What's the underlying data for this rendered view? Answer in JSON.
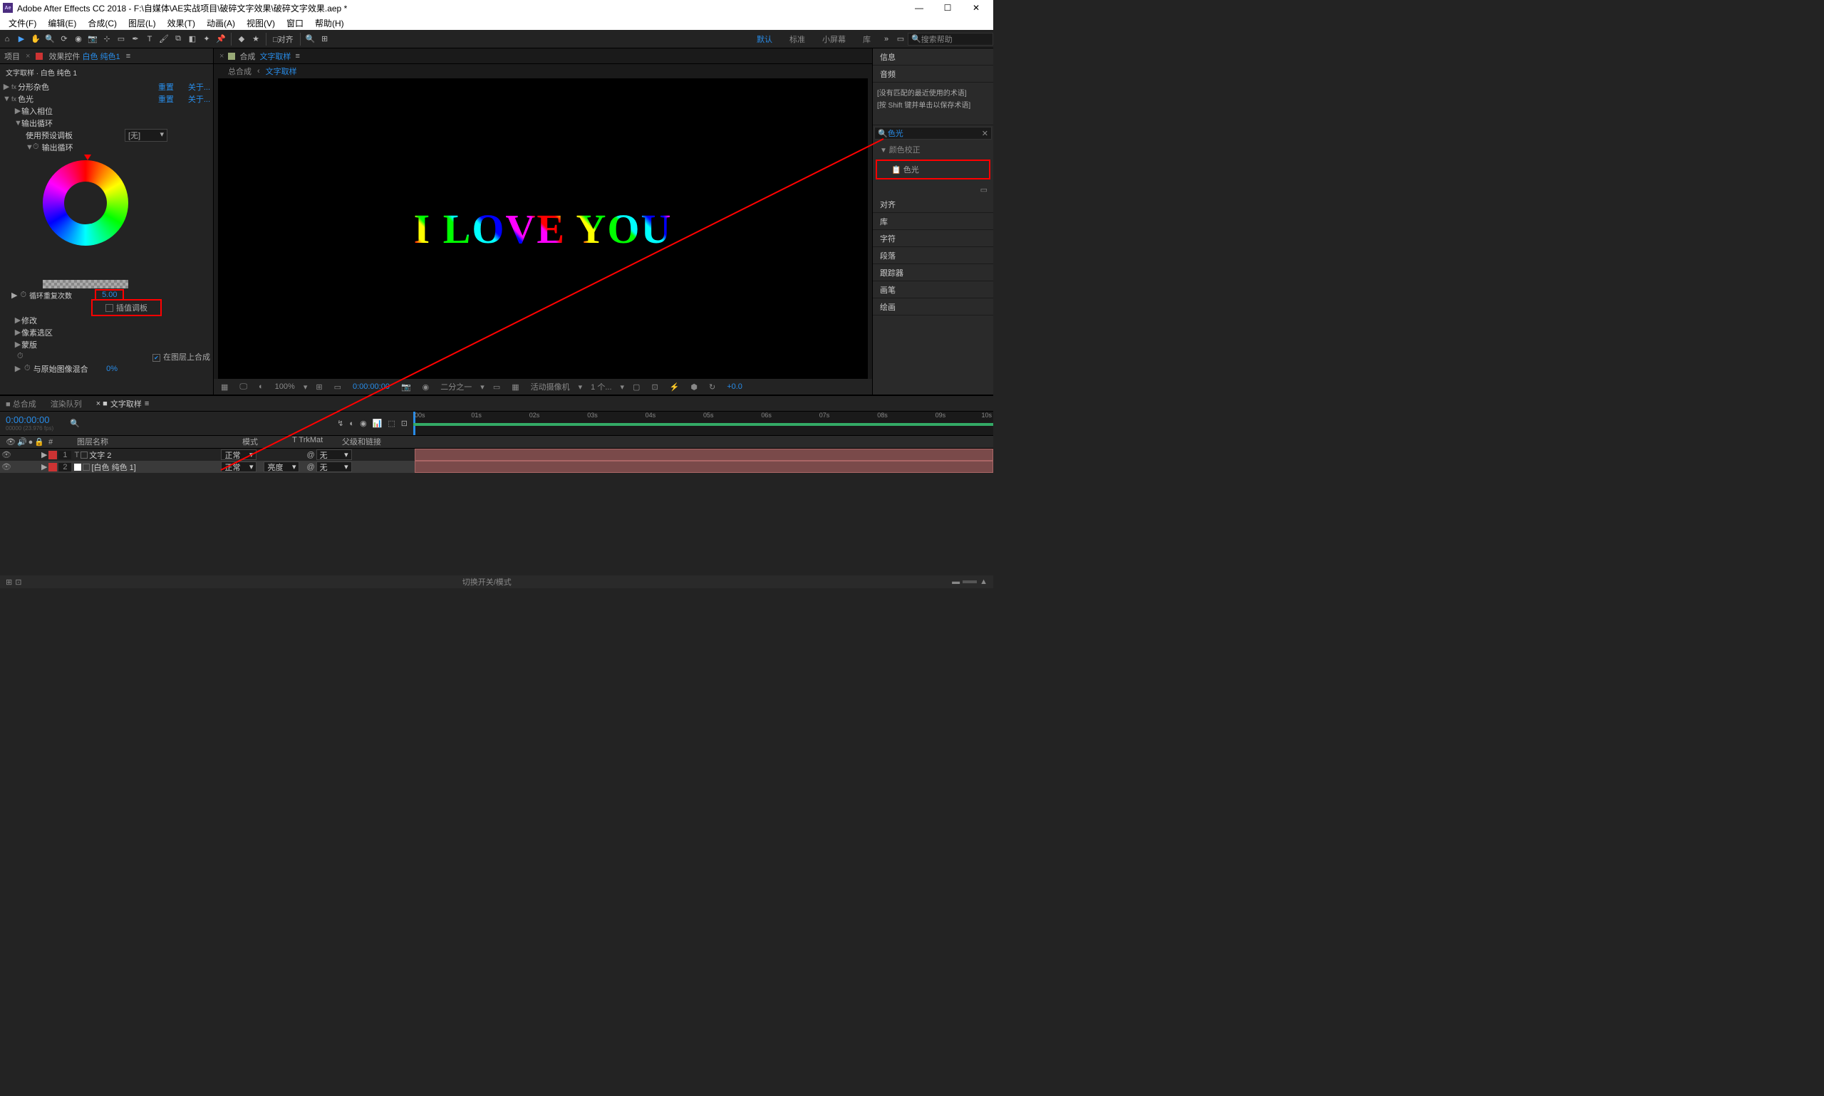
{
  "titlebar": {
    "app_icon": "Ae",
    "title": "Adobe After Effects CC 2018 - F:\\自媒体\\AE实战项目\\破碎文字效果\\破碎文字效果.aep *"
  },
  "menubar": {
    "items": [
      "文件(F)",
      "编辑(E)",
      "合成(C)",
      "图层(L)",
      "效果(T)",
      "动画(A)",
      "视图(V)",
      "窗口",
      "帮助(H)"
    ]
  },
  "toolbar": {
    "snap_label": "□对齐",
    "workspaces": {
      "active": "默认",
      "items": [
        "标准",
        "小屏幕",
        "库"
      ]
    },
    "search_placeholder": "搜索帮助"
  },
  "effects_panel": {
    "tabs": {
      "project": "项目",
      "effect_controls_prefix": "效果控件",
      "effect_controls_layer": "白色 纯色1"
    },
    "layer_name": "文字取样 · 白色 纯色 1",
    "fx1": {
      "name": "分形杂色",
      "reset": "重置",
      "about": "关于..."
    },
    "fx2": {
      "name": "色光",
      "reset": "重置",
      "about": "关于..."
    },
    "params": {
      "input_phase": "输入相位",
      "output_cycle": "输出循环",
      "use_preset": "使用预设调板",
      "preset_value": "[无]",
      "output_cycle_sub": "输出循环",
      "repeat_label": "循环重复次数",
      "repeat_value": "5.00",
      "interp_checkbox": "插值调板",
      "modify": "修改",
      "pixel_select": "像素选区",
      "mask": "蒙版",
      "comp_in_layer": "在图层上合成",
      "blend_original": "与原始图像混合",
      "blend_value": "0%"
    }
  },
  "comp_panel": {
    "tab_label": "合成",
    "tab_name": "文字取样",
    "breadcrumb_root": "总合成",
    "breadcrumb_current": "文字取样",
    "preview_text": "I LOVE YOU",
    "footer": {
      "zoom": "100%",
      "timecode": "0:00:00:00",
      "res": "二分之一",
      "camera": "活动摄像机",
      "views": "1 个...",
      "exposure": "+0.0"
    }
  },
  "right_panels": {
    "items": [
      "信息",
      "音频"
    ],
    "recent1": "[没有匹配的最近使用的术语]",
    "recent2": "[按 Shift 键并单击以保存术语]",
    "search_value": "色光",
    "category": "颜色校正",
    "result": "色光",
    "panels2": [
      "对齐",
      "库",
      "字符",
      "段落",
      "跟踪器",
      "画笔",
      "绘画"
    ]
  },
  "timeline": {
    "tabs": {
      "main": "总合成",
      "render": "渲染队列",
      "active": "文字取样"
    },
    "timecode": "0:00:00:00",
    "fps_line": "00000 (23.976 fps)",
    "cols": {
      "layer_name": "图层名称",
      "mode": "模式",
      "trkmat": "TrkMat",
      "parent": "父级和链接"
    },
    "layers": [
      {
        "num": "1",
        "name": "文字 2",
        "mode": "正常",
        "trk": "",
        "parent": "无",
        "color": "#c33",
        "type": "T"
      },
      {
        "num": "2",
        "name": "[白色 纯色 1]",
        "mode": "正常",
        "trk": "亮度",
        "parent": "无",
        "color": "#c33",
        "type": "□"
      }
    ],
    "ruler": [
      "00s",
      "01s",
      "02s",
      "03s",
      "04s",
      "05s",
      "06s",
      "07s",
      "08s",
      "09s",
      "10s"
    ],
    "footer_center": "切换开关/模式"
  }
}
